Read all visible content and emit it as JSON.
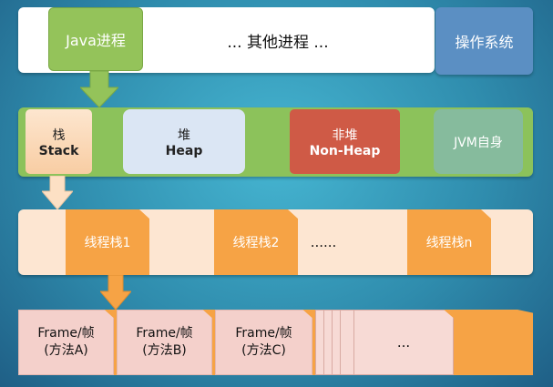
{
  "processes": {
    "java": "Java进程",
    "others": "... 其他进程 ...",
    "os": "操作系统"
  },
  "memory": {
    "stack_cn": "栈",
    "stack_en": "Stack",
    "heap_cn": "堆",
    "heap_en": "Heap",
    "nonheap_cn": "非堆",
    "nonheap_en": "Non-Heap",
    "jvm": "JVM自身"
  },
  "threads": {
    "t1": "线程栈1",
    "t2": "线程栈2",
    "ellipsis": "......",
    "tn": "线程栈n"
  },
  "frames": {
    "label": "Frame/帧",
    "a": "(方法A)",
    "b": "(方法B)",
    "c": "(方法C)",
    "more": "..."
  },
  "colors": {
    "green": "#94c35a",
    "blue": "#5b8fc3",
    "red": "#cf5a46",
    "teal": "#86bb9d",
    "orange": "#f6a345",
    "peach": "#fde6d2",
    "pink": "#f4d0cb"
  }
}
